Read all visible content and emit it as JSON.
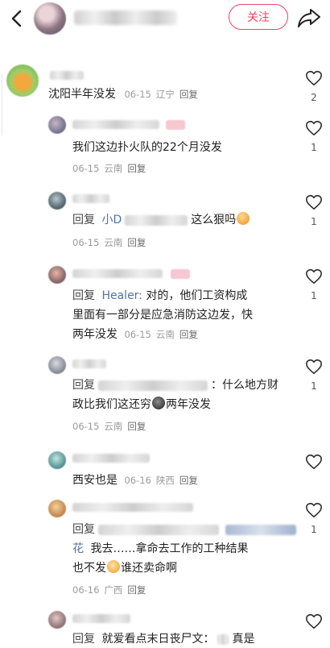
{
  "header": {
    "follow_label": "关注"
  },
  "comments": [
    {
      "text": "沈阳半年没发",
      "date": "06-15",
      "region": "辽宁",
      "reply_label": "回复",
      "likes": "2"
    },
    {
      "text": "我们这边扑火队的22个月没发",
      "date": "06-15",
      "region": "云南",
      "reply_label": "回复",
      "likes": "1"
    },
    {
      "reply_word": "回复",
      "mention": "小D",
      "text": "这么狠吗",
      "emoji": "peach-emoji",
      "date": "06-15",
      "region": "云南",
      "reply_label": "回复",
      "likes": "1"
    },
    {
      "reply_word": "回复",
      "mention": "Healer:",
      "line1": "对的，他们工资构成",
      "line2": "里面有一部分是应急消防这边发，快",
      "line3": "两年没发",
      "date": "06-15",
      "region": "云南",
      "reply_label": "回复",
      "likes": "1"
    },
    {
      "reply_word": "回复",
      "line1": "：什么地方财",
      "line2a": "政比我们这还穷",
      "line2b": "两年没发",
      "emoji": "cat-emoji",
      "date": "06-15",
      "region": "云南",
      "reply_label": "回复",
      "likes": "1"
    },
    {
      "text": "西安也是",
      "date": "06-16",
      "region": "陕西",
      "reply_label": "回复",
      "likes": ""
    },
    {
      "reply_word": "回复",
      "mention_end": "花",
      "line1": "我去……拿命去工作的工种结果",
      "line2a": "也不发",
      "line2b": "谁还卖命啊",
      "emoji": "cry-emoji",
      "date": "06-16",
      "region": "广西",
      "reply_label": "回复",
      "likes": "1"
    },
    {
      "reply_word": "回复",
      "line1": "就爱看点末日丧尸文：",
      "line_end": "真是",
      "likes": ""
    }
  ]
}
